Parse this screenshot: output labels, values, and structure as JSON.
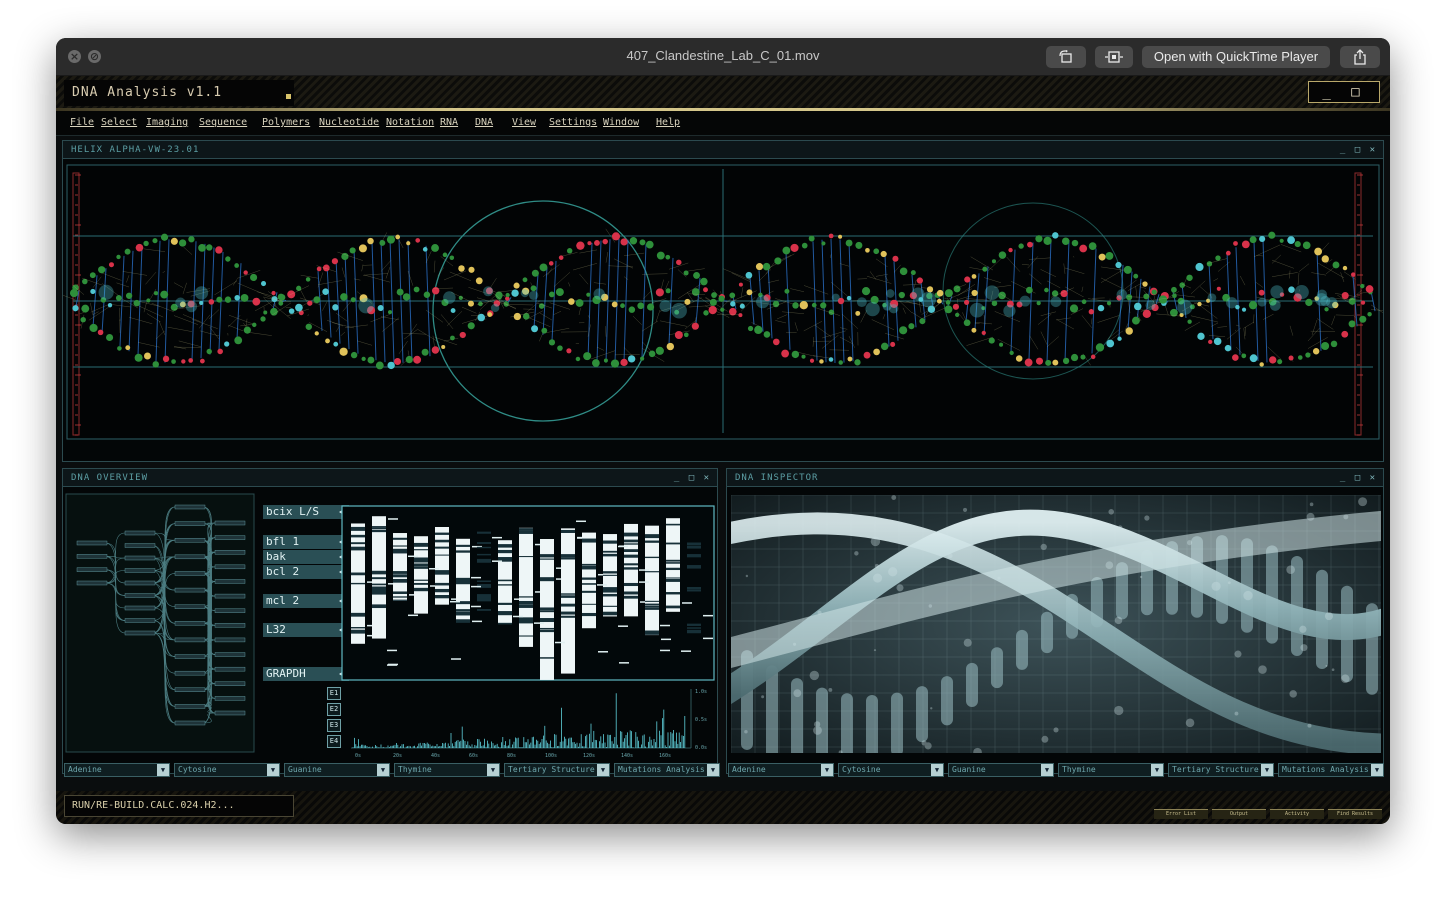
{
  "window": {
    "title": "407_Clandestine_Lab_C_01.mov",
    "open_with_label": "Open with QuickTime Player",
    "close_icon": "close-icon",
    "stop_icon": "stop-icon"
  },
  "app": {
    "name": "DNA Analysis v1.1",
    "controls": "_ □ ✕"
  },
  "menu": [
    "File",
    "Select",
    "Imaging",
    "Sequence",
    "Polymers",
    "Nucleotide",
    "Notation",
    "RNA",
    "DNA",
    "View",
    "Settings",
    "Window",
    "Help"
  ],
  "helix_panel": {
    "title": "HELIX ALPHA-VW-23.01",
    "controls": "_ □ ✕"
  },
  "overview_panel": {
    "title": "DNA OVERVIEW",
    "controls": "_ □ ✕",
    "gene_labels": [
      "bcix L/S",
      "bfl 1",
      "bak",
      "bcl 2",
      "mcl 2",
      "L32",
      "GRAPDH"
    ],
    "e_labels": [
      "E1",
      "E2",
      "E3",
      "E4"
    ],
    "x_ticks": [
      "0s",
      "20s",
      "40s",
      "60s",
      "80s",
      "100s",
      "120s",
      "140s",
      "160s"
    ],
    "y_ticks": [
      "1.0s",
      "0.5s",
      "0.0s"
    ],
    "dropdowns": [
      "Adenine",
      "Cytosine",
      "Guanine",
      "Thymine",
      "Tertiary Structure",
      "Mutations Analysis"
    ]
  },
  "inspector_panel": {
    "title": "DNA INSPECTOR",
    "controls": "_ □ ✕",
    "dropdowns": [
      "Adenine",
      "Cytosine",
      "Guanine",
      "Thymine",
      "Tertiary Structure",
      "Mutations Analysis"
    ]
  },
  "status": {
    "command": "RUN/RE-BUILD.CALC.024.H2...",
    "buttons": [
      "Error List",
      "Output",
      "Activity",
      "Find Results"
    ]
  },
  "colors": {
    "teal": "#4fc4cf",
    "gold": "#d4c68a",
    "green_atom": "#2e8f3a",
    "red_atom": "#d8324a",
    "blue_bond": "#2f7de0"
  }
}
